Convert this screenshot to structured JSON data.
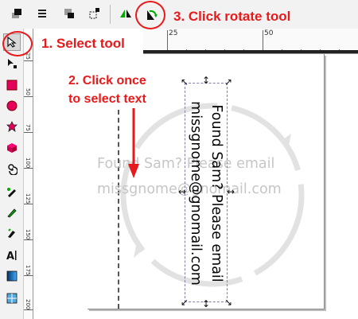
{
  "annotations": {
    "step1": "1. Select tool",
    "step2_line1": "2. Click once",
    "step2_line2": "to select text",
    "step3": "3. Click rotate tool",
    "accent_color": "#e8191a"
  },
  "ruler": {
    "h_labels": [
      "25",
      "50"
    ],
    "v_labels": [
      "25",
      "50",
      "75",
      "100",
      "125",
      "150",
      "175",
      "200"
    ]
  },
  "canvas": {
    "watermark_line1": "Found Sam? Please email",
    "watermark_line2": "missgnome@gnomail.com",
    "text_line1": "Found Sam? Please email",
    "text_line2": "missgnome@gnomail.com"
  },
  "icons": {
    "toolbar": [
      "raise-to-top-icon",
      "raise-icon",
      "lower-icon",
      "align-icon",
      "flip-horizontal-icon",
      "rotate-icon"
    ],
    "tools": [
      "selector-icon",
      "node-icon",
      "rectangle-icon",
      "circle-icon",
      "star-icon",
      "box-3d-icon",
      "spiral-icon",
      "pen-icon",
      "pencil-icon",
      "calligraphy-icon",
      "text-icon",
      "gradient-icon",
      "mesh-icon"
    ]
  }
}
